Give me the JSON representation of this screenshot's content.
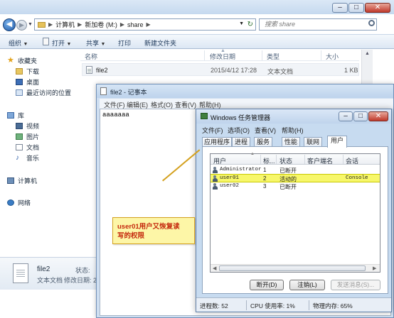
{
  "explorer": {
    "breadcrumb": [
      "计算机",
      "新加卷 (M:)",
      "share"
    ],
    "search_placeholder": "搜索 share",
    "toolbar": {
      "organize": "组织",
      "open": "打开",
      "share": "共享",
      "print": "打印",
      "new_folder": "新建文件夹"
    },
    "columns": {
      "name": "名称",
      "modified": "修改日期",
      "type": "类型",
      "size": "大小"
    },
    "file": {
      "name": "file2",
      "modified": "2015/4/12 17:28",
      "type": "文本文档",
      "size": "1 KB"
    },
    "sidebar": {
      "favorites": "收藏夹",
      "downloads": "下载",
      "desktop": "桌面",
      "recent": "最近访问的位置",
      "libraries": "库",
      "videos": "视频",
      "pictures": "图片",
      "documents": "文档",
      "music": "音乐",
      "computer": "计算机",
      "network": "网络"
    },
    "details": {
      "name": "file2",
      "type": "文本文档",
      "state_label": "状态:",
      "modified_label": "修改日期: 2"
    }
  },
  "notepad": {
    "title": "file2 - 记事本",
    "menu": [
      "文件(F)",
      "编辑(E)",
      "格式(O)",
      "查看(V)",
      "帮助(H)"
    ],
    "content": "aaaaaaa"
  },
  "taskmgr": {
    "title": "Windows 任务管理器",
    "menu": [
      "文件(F)",
      "选项(O)",
      "查看(V)",
      "帮助(H)"
    ],
    "tabs": [
      "应用程序",
      "进程",
      "服务",
      "性能",
      "联网",
      "用户"
    ],
    "active_tab": "用户",
    "columns": [
      "用户",
      "标...",
      "状态",
      "客户端名",
      "会话"
    ],
    "rows": [
      {
        "user": "Administrator",
        "id": "1",
        "status": "已断开",
        "client": "",
        "session": ""
      },
      {
        "user": "user01",
        "id": "2",
        "status": "活动的",
        "client": "",
        "session": "Console"
      },
      {
        "user": "user02",
        "id": "3",
        "status": "已断开",
        "client": "",
        "session": ""
      }
    ],
    "selected_row": 1,
    "buttons": {
      "disconnect": "断开(D)",
      "logoff": "注销(L)",
      "send_message": "发送消息(S)..."
    },
    "status": {
      "processes": "进程数: 52",
      "cpu": "CPU 使用率: 1%",
      "memory": "物理内存: 65%"
    }
  },
  "callout": {
    "line1": "user01用户又恢复读",
    "line2": "写的权限"
  }
}
